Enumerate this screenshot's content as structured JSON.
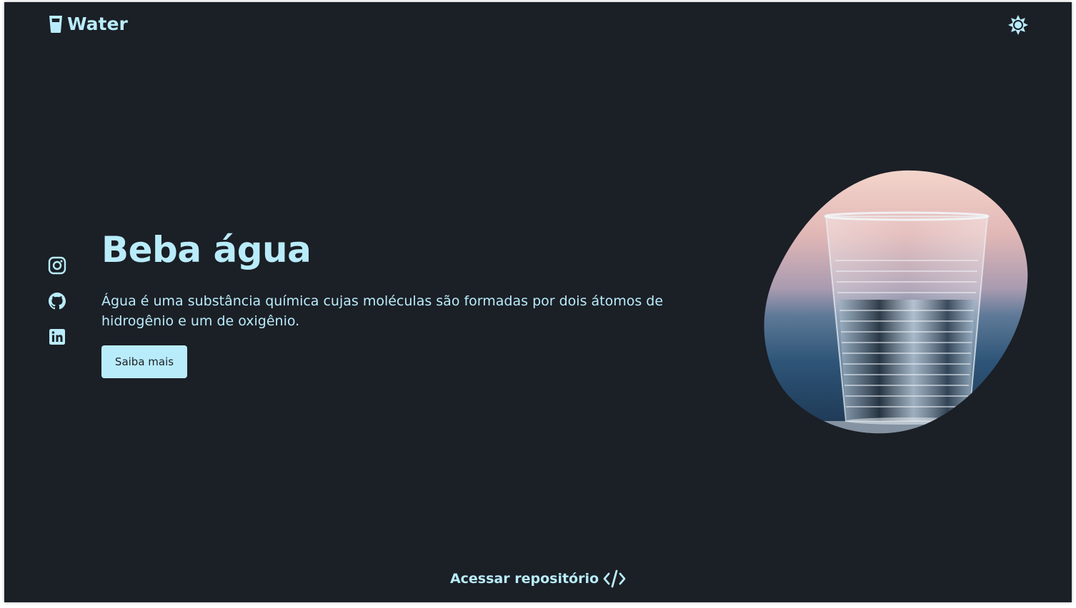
{
  "header": {
    "brand_label": "Water",
    "brand_icon": "cup-icon",
    "theme_toggle_icon": "sun-icon"
  },
  "socials": [
    {
      "name": "instagram",
      "icon": "instagram-icon"
    },
    {
      "name": "github",
      "icon": "github-icon"
    },
    {
      "name": "linkedin",
      "icon": "linkedin-icon"
    }
  ],
  "hero": {
    "title": "Beba água",
    "description": "Água é uma substância química cujas moléculas são formadas por dois átomos de hidrogênio e um de oxigênio.",
    "cta_label": "Saiba mais",
    "image": "water-cup-photo"
  },
  "footer": {
    "repo_label": "Acessar repositório",
    "repo_icon": "code-icon"
  },
  "colors": {
    "background": "#1b1f26",
    "accent": "#b9ecfb"
  }
}
